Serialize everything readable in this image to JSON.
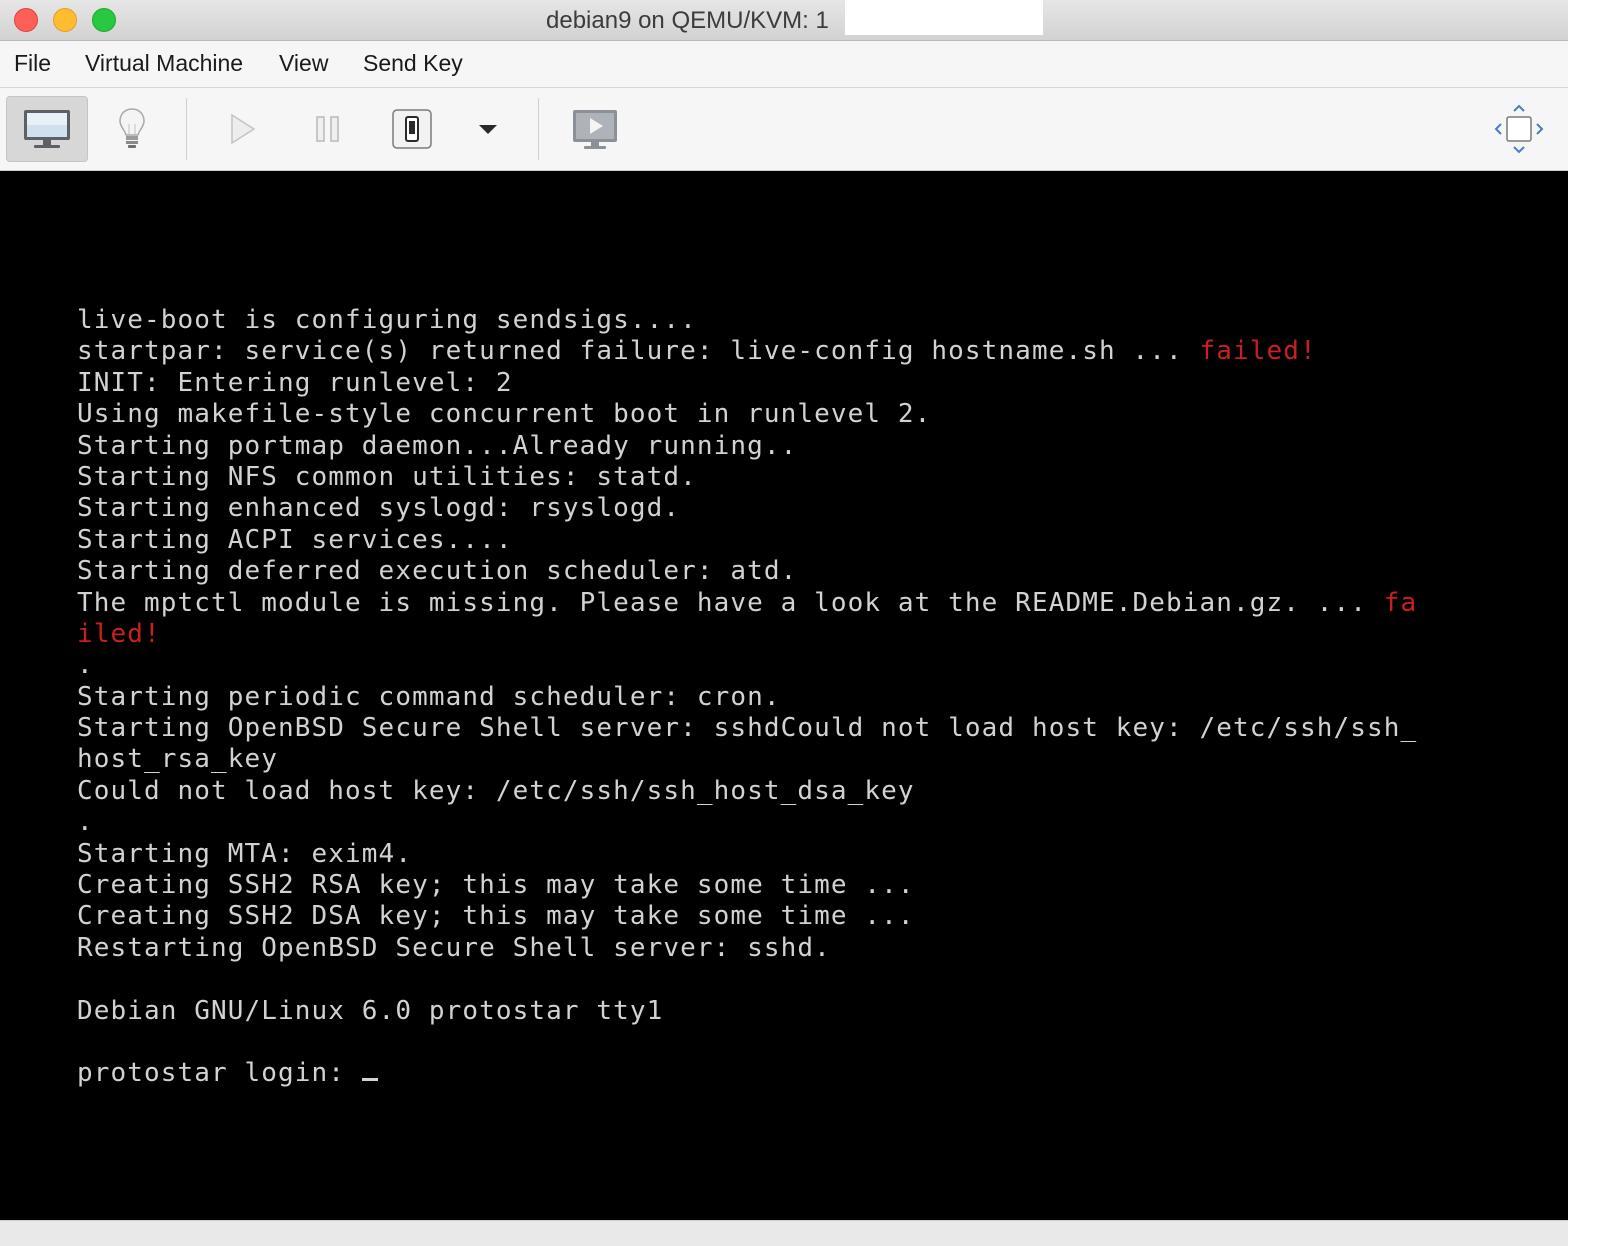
{
  "window": {
    "title": "debian9 on QEMU/KVM: 1",
    "title_redacted": true
  },
  "menubar": {
    "items": [
      {
        "label": "File"
      },
      {
        "label": "Virtual Machine"
      },
      {
        "label": "View"
      },
      {
        "label": "Send Key"
      }
    ]
  },
  "toolbar": {
    "buttons": [
      {
        "icon": "monitor-icon",
        "name": "show-console",
        "active": true
      },
      {
        "icon": "lightbulb-icon",
        "name": "show-details",
        "active": false
      },
      {
        "icon": "play-icon",
        "name": "run",
        "active": false
      },
      {
        "icon": "pause-icon",
        "name": "pause",
        "active": false
      },
      {
        "icon": "shutdown-icon",
        "name": "shutdown",
        "active": false
      },
      {
        "icon": "chevron-down-icon",
        "name": "shutdown-menu",
        "active": false
      },
      {
        "icon": "snapshots-icon",
        "name": "snapshots",
        "active": false
      },
      {
        "icon": "fullscreen-icon",
        "name": "fullscreen",
        "active": false
      }
    ]
  },
  "console": {
    "lines": [
      {
        "text": "live-boot is configuring sendsigs....",
        "tail": ""
      },
      {
        "text": "startpar: service(s) returned failure: live-config hostname.sh ... ",
        "tail": "failed!"
      },
      {
        "text": "INIT: Entering runlevel: 2",
        "tail": ""
      },
      {
        "text": "Using makefile-style concurrent boot in runlevel 2.",
        "tail": ""
      },
      {
        "text": "Starting portmap daemon...Already running..",
        "tail": ""
      },
      {
        "text": "Starting NFS common utilities: statd.",
        "tail": ""
      },
      {
        "text": "Starting enhanced syslogd: rsyslogd.",
        "tail": ""
      },
      {
        "text": "Starting ACPI services....",
        "tail": ""
      },
      {
        "text": "Starting deferred execution scheduler: atd.",
        "tail": ""
      },
      {
        "text": "The mptctl module is missing. Please have a look at the README.Debian.gz. ... ",
        "tail": "fa"
      },
      {
        "text": "",
        "tail": "iled!"
      },
      {
        "text": ".",
        "tail": ""
      },
      {
        "text": "Starting periodic command scheduler: cron.",
        "tail": ""
      },
      {
        "text": "Starting OpenBSD Secure Shell server: sshdCould not load host key: /etc/ssh/ssh_",
        "tail": ""
      },
      {
        "text": "host_rsa_key",
        "tail": ""
      },
      {
        "text": "Could not load host key: /etc/ssh/ssh_host_dsa_key",
        "tail": ""
      },
      {
        "text": ".",
        "tail": ""
      },
      {
        "text": "Starting MTA: exim4.",
        "tail": ""
      },
      {
        "text": "Creating SSH2 RSA key; this may take some time ...",
        "tail": ""
      },
      {
        "text": "Creating SSH2 DSA key; this may take some time ...",
        "tail": ""
      },
      {
        "text": "Restarting OpenBSD Secure Shell server: sshd.",
        "tail": ""
      },
      {
        "text": "",
        "tail": ""
      },
      {
        "text": "Debian GNU/Linux 6.0 protostar tty1",
        "tail": ""
      },
      {
        "text": "",
        "tail": ""
      }
    ],
    "prompt": "protostar login: ",
    "colors": {
      "text": "#d2d2d2",
      "error": "#c8201e",
      "background": "#000000"
    }
  }
}
